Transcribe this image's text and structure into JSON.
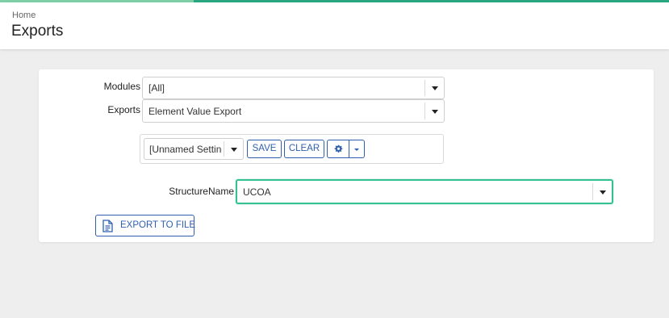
{
  "header": {
    "breadcrumb": "Home",
    "title": "Exports"
  },
  "form": {
    "modules": {
      "label": "Modules",
      "value": "[All]"
    },
    "exports": {
      "label": "Exports",
      "value": "Element Value Export"
    },
    "settings": {
      "selected": "[Unnamed Setting",
      "save_label": "SAVE",
      "clear_label": "CLEAR"
    },
    "structure": {
      "label": "StructureName",
      "value": "UCOA"
    },
    "export_button_label": "EXPORT TO FILE"
  },
  "colors": {
    "accent": "#2f5fae",
    "focus": "#34c08f",
    "topbar_light": "#7fd0a8",
    "topbar_dark": "#2aa782"
  }
}
